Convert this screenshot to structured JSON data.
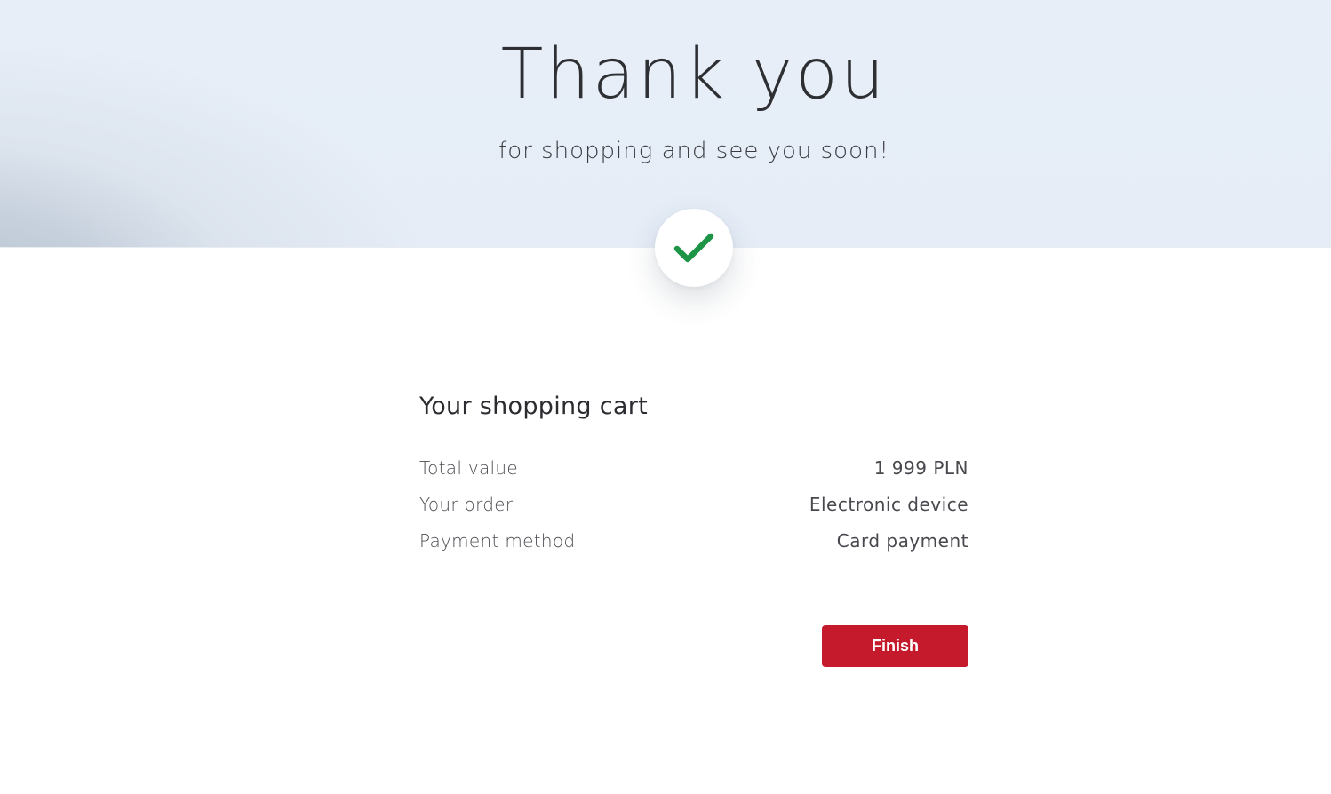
{
  "hero": {
    "title": "Thank you",
    "subtitle": "for shopping and see you soon!",
    "check_icon": "checkmark-icon",
    "check_color": "#1e9446"
  },
  "cart": {
    "title": "Your shopping cart",
    "rows": [
      {
        "label": "Total value",
        "value": "1 999 PLN"
      },
      {
        "label": "Your order",
        "value": "Electronic device"
      },
      {
        "label": "Payment method",
        "value": "Card payment"
      }
    ]
  },
  "actions": {
    "finish_label": "Finish",
    "finish_color": "#c41a2b"
  }
}
